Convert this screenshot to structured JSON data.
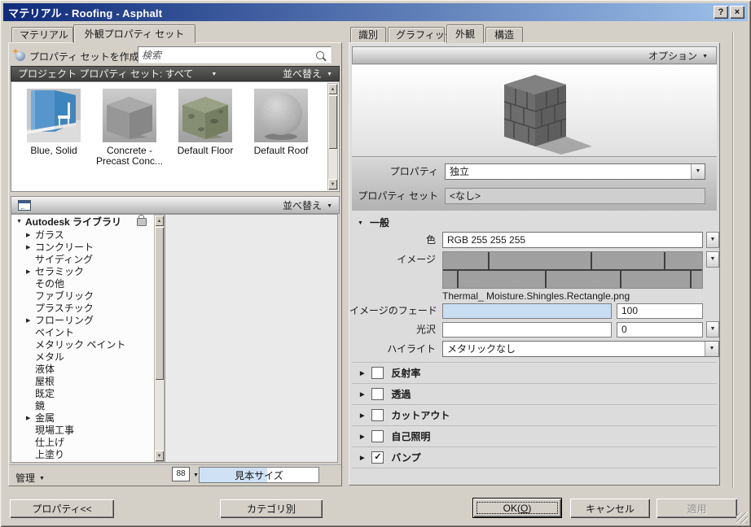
{
  "window": {
    "title": "マテリアル - Roofing - Asphalt"
  },
  "icons": {
    "dropdown": "▼",
    "expand": "▶",
    "collapse": "▼",
    "check": "✓",
    "help": "?",
    "close": "×",
    "up": "▲",
    "down": "▼"
  },
  "left_panel": {
    "tabs": [
      {
        "label": "マテリアル"
      },
      {
        "label": "外観プロパティ セット"
      }
    ],
    "toolbar": {
      "create_set_button": "プロパティ セットを作成",
      "search_placeholder": "検索"
    },
    "filter_bar": {
      "label": "プロジェクト プロパティ セット: すべて",
      "sort_label": "並べ替え"
    },
    "thumbnails": [
      {
        "name": "Blue, Solid"
      },
      {
        "name": "Concrete - Precast Conc..."
      },
      {
        "name": "Default Floor"
      },
      {
        "name": "Default Roof"
      }
    ],
    "library_bar": {
      "sort_label": "並べ替え"
    },
    "tree": {
      "root_label": "Autodesk ライブラリ",
      "items": [
        {
          "arrow": "▶",
          "label": "ガラス"
        },
        {
          "arrow": "▶",
          "label": "コンクリート"
        },
        {
          "arrow": "",
          "label": "サイディング"
        },
        {
          "arrow": "▶",
          "label": "セラミック"
        },
        {
          "arrow": "",
          "label": "その他"
        },
        {
          "arrow": "",
          "label": "ファブリック"
        },
        {
          "arrow": "",
          "label": "プラスチック"
        },
        {
          "arrow": "▶",
          "label": "フローリング"
        },
        {
          "arrow": "",
          "label": "ペイント"
        },
        {
          "arrow": "",
          "label": "メタリック ペイント"
        },
        {
          "arrow": "",
          "label": "メタル"
        },
        {
          "arrow": "",
          "label": "液体"
        },
        {
          "arrow": "",
          "label": "屋根"
        },
        {
          "arrow": "",
          "label": "既定"
        },
        {
          "arrow": "",
          "label": "鏡"
        },
        {
          "arrow": "▶",
          "label": "金属"
        },
        {
          "arrow": "",
          "label": "現場工事"
        },
        {
          "arrow": "",
          "label": "仕上げ"
        },
        {
          "arrow": "",
          "label": "上塗り"
        }
      ]
    },
    "footer": {
      "manage_label": "管理",
      "view_button": "88",
      "sample_size_value": "見本サイズ"
    }
  },
  "right_panel": {
    "tabs": [
      {
        "label": "識別"
      },
      {
        "label": "グラフィックス"
      },
      {
        "label": "外観"
      },
      {
        "label": "構造"
      }
    ],
    "options_label": "オプション",
    "property_row": {
      "label": "プロパティ",
      "value": "独立"
    },
    "property_set_row": {
      "label": "プロパティ セット",
      "value": "<なし>"
    },
    "general": {
      "header": "一般",
      "color_row": {
        "label": "色",
        "value": "RGB 255 255 255"
      },
      "image_row": {
        "label": "イメージ",
        "filename": "Thermal_ Moisture.Shingles.Rectangle.png"
      },
      "fade_row": {
        "label": "イメージのフェード",
        "value": "100"
      },
      "gloss_row": {
        "label": "光沢",
        "value": "0"
      },
      "highlight_row": {
        "label": "ハイライト",
        "value": "メタリックなし"
      }
    },
    "sections": [
      {
        "arrow": "▶",
        "check": "",
        "label": "反射率"
      },
      {
        "arrow": "▶",
        "check": "",
        "label": "透過"
      },
      {
        "arrow": "▶",
        "check": "",
        "label": "カットアウト"
      },
      {
        "arrow": "▶",
        "check": "",
        "label": "自己照明"
      },
      {
        "arrow": "▶",
        "check": "✓",
        "label": "バンプ"
      }
    ]
  },
  "footer": {
    "properties_button": "プロパティ<<",
    "category_button": "カテゴリ別",
    "ok_button": {
      "prefix": "OK(",
      "key": "O",
      "suffix": ")"
    },
    "cancel_button": "キャンセル",
    "apply_button": "適用"
  },
  "colors": {
    "titlebar_left": "#0f2b7a",
    "titlebar_right": "#9ec1ea",
    "dialog_bg": "#d4d0c8",
    "fade_fill": "#c9def2",
    "selection": "#cfe2f5"
  }
}
